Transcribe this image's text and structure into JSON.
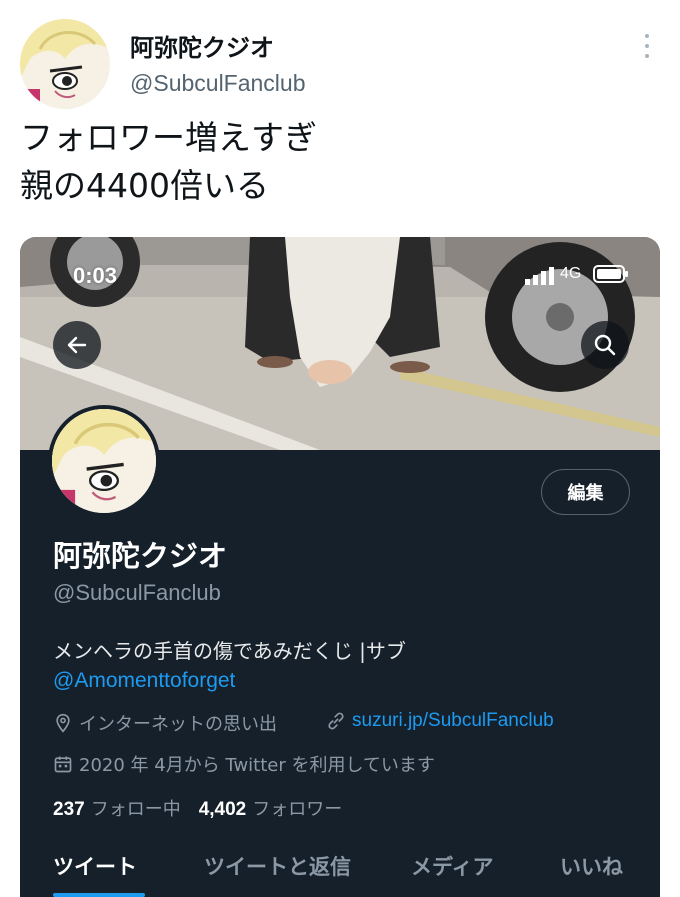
{
  "tweet": {
    "display_name": "阿弥陀クジオ",
    "handle": "@SubculFanclub",
    "text": "フォロワー増えすぎ\n親の4400倍いる",
    "more_icon": "vertical-dots-icon"
  },
  "screenshot": {
    "status_bar": {
      "time": "0:03",
      "network": "4G"
    },
    "profile": {
      "display_name": "阿弥陀クジオ",
      "handle": "@SubculFanclub",
      "edit_button": "編集",
      "bio": "メンヘラの手首の傷であみだくじ |サブ",
      "bio_mention": "@Amomenttoforget",
      "location": "インターネットの思い出",
      "website": "suzuri.jp/SubculFanclub",
      "joined": "2020 年 4月から Twitter を利用しています",
      "following_count": "237",
      "following_label": "フォロー中",
      "followers_count": "4,402",
      "followers_label": "フォロワー"
    },
    "tabs": [
      {
        "label": "ツイート",
        "active": true
      },
      {
        "label": "ツイートと返信",
        "active": false
      },
      {
        "label": "メディア",
        "active": false
      },
      {
        "label": "いいね",
        "active": false
      }
    ]
  },
  "colors": {
    "accent": "#1d9bf0",
    "dark_bg": "#15202b",
    "muted": "#8b98a5"
  }
}
